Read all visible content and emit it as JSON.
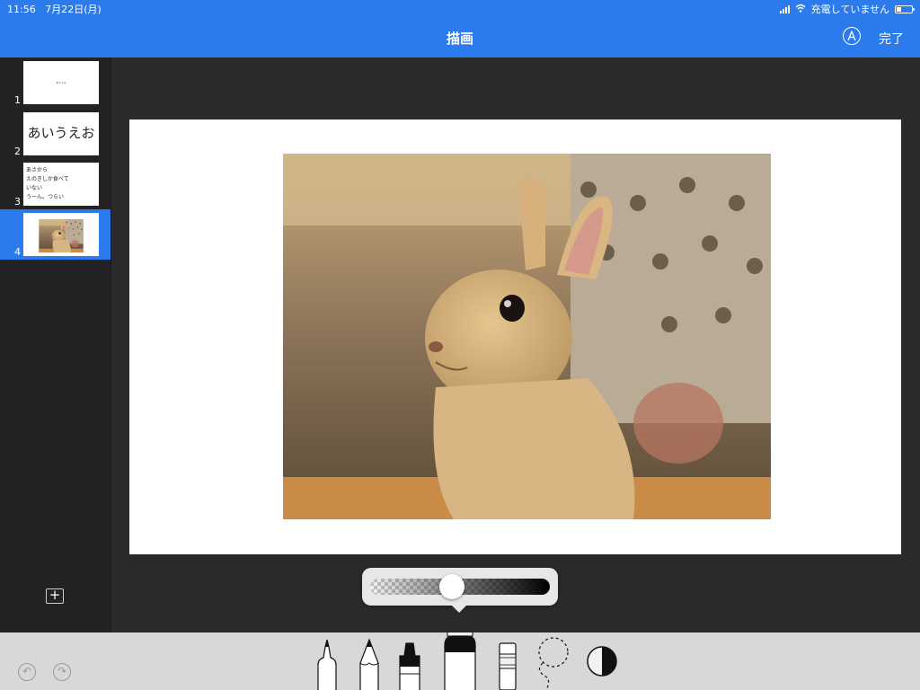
{
  "status_bar": {
    "time": "11:56",
    "date": "7月22日(月)",
    "charging_text": "充電していません"
  },
  "header": {
    "title": "描画",
    "done_label": "完了"
  },
  "sidebar": {
    "slides": [
      {
        "number": "1",
        "content": "タイトル"
      },
      {
        "number": "2",
        "content": "あいうえお"
      },
      {
        "number": "3",
        "lines": [
          "あさから",
          "えのきしか食べて",
          "いない",
          "うーん。つらい"
        ]
      },
      {
        "number": "4",
        "content_type": "photo"
      }
    ],
    "selected_index": 3
  },
  "opacity": {
    "value": 0.45
  },
  "colors": {
    "accent": "#2b7bec",
    "canvas_bg": "#2a2a2c",
    "toolbar_bg": "#d8d8d8"
  },
  "tools": [
    "pen-tool",
    "pencil-tool",
    "crayon-tool",
    "fill-tool",
    "eraser-tool",
    "lasso-tool",
    "color-picker"
  ],
  "selected_tool": "fill-tool"
}
